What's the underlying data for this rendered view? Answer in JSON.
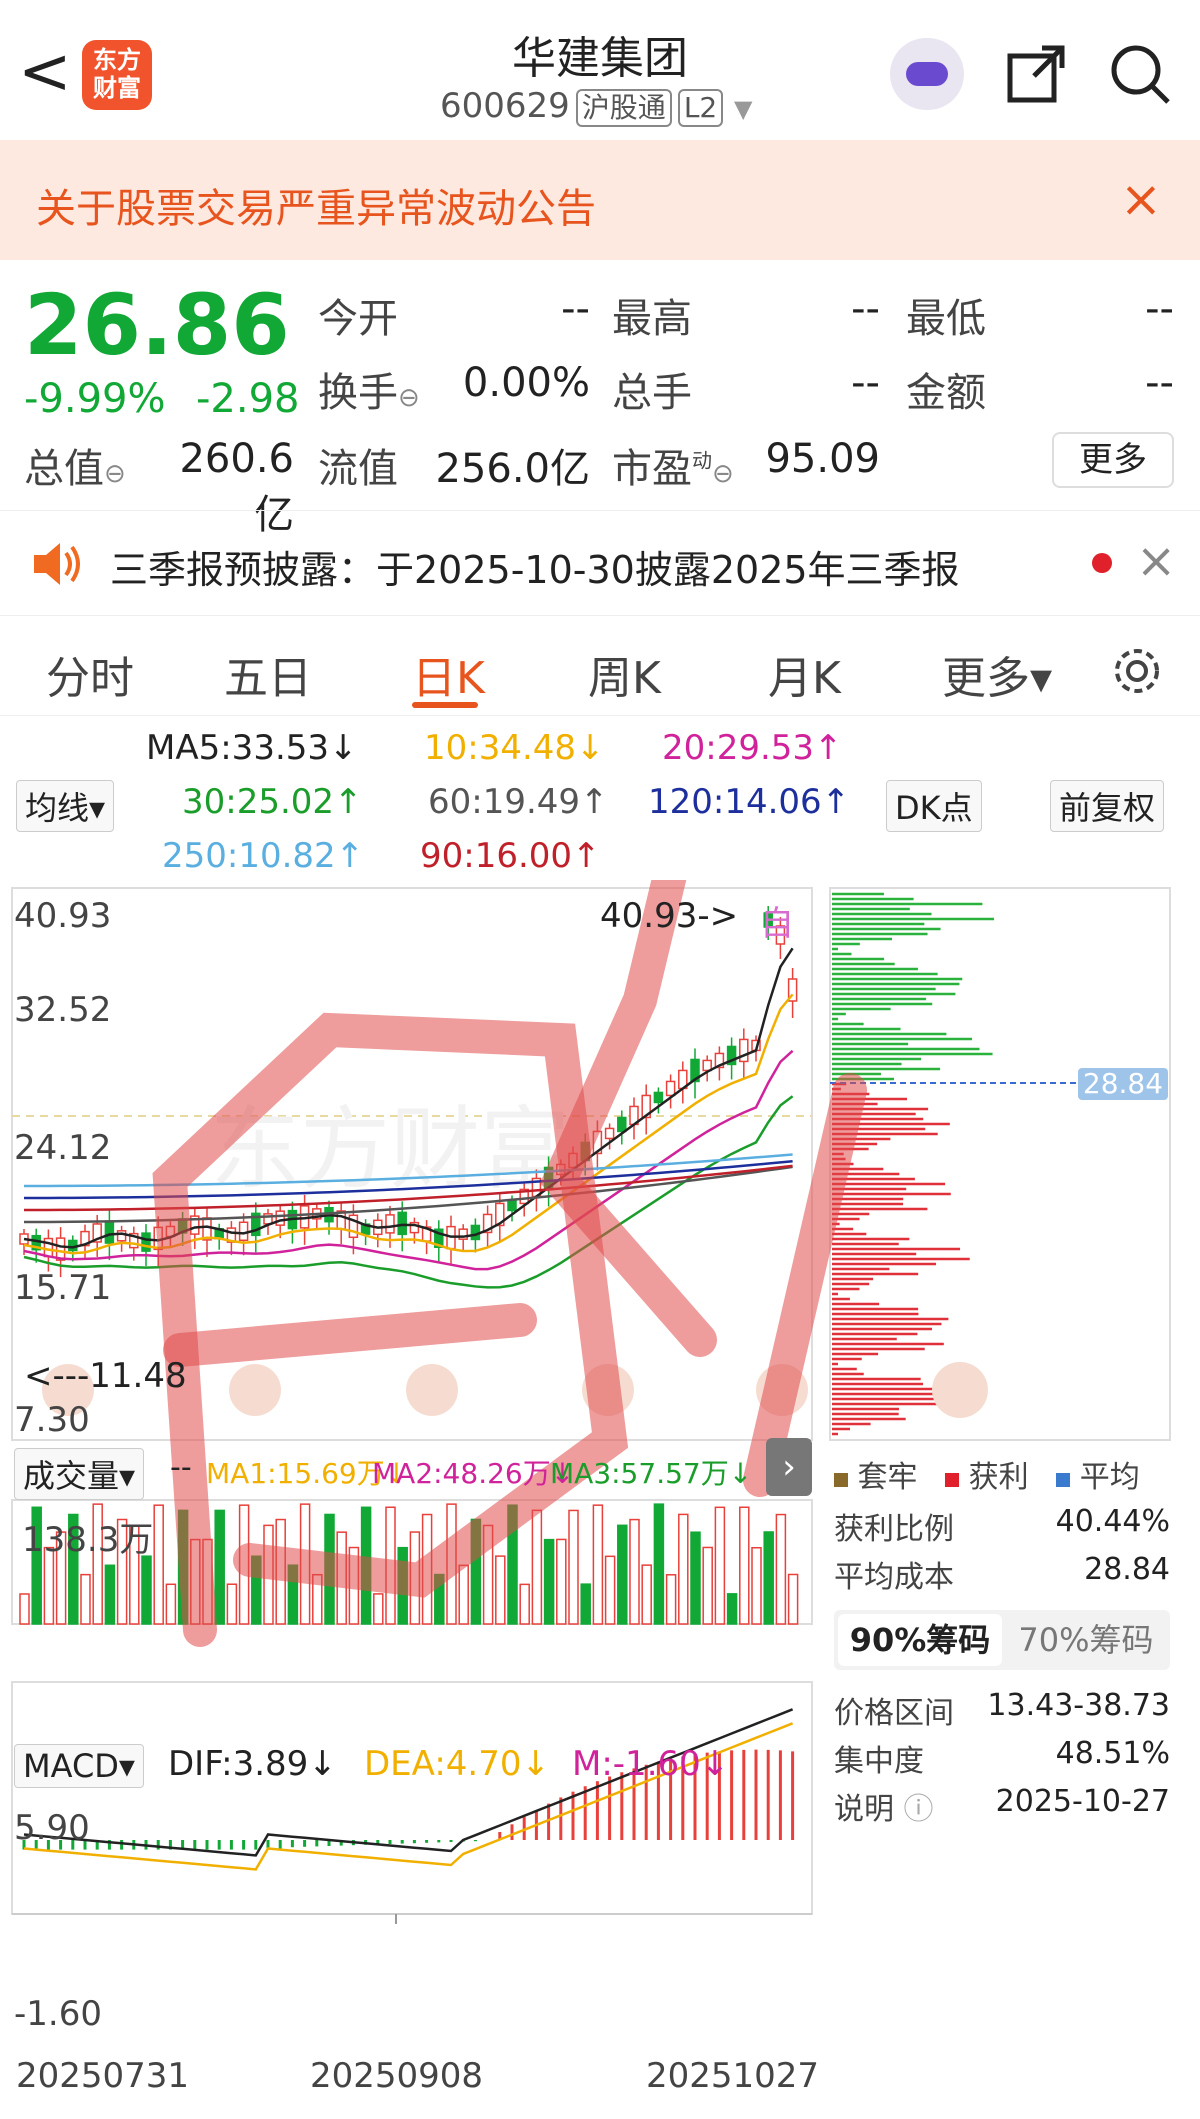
{
  "header": {
    "back_label": "<",
    "logo_text": "东方财富",
    "stock_name": "华建集团",
    "stock_code": "600629",
    "tag1": "沪股通",
    "tag2": "L2"
  },
  "notice": {
    "text": "关于股票交易严重异常波动公告",
    "close": "×"
  },
  "quote": {
    "price": "26.86",
    "change_pct": "-9.99%",
    "change": "-2.98",
    "open_label": "今开",
    "open": "--",
    "high_label": "最高",
    "high": "--",
    "low_label": "最低",
    "low": "--",
    "turnover_label": "换手",
    "turnover": "0.00%",
    "volume_label": "总手",
    "volume": "--",
    "amount_label": "金额",
    "amount": "--",
    "mcap_label": "总值",
    "mcap": "260.6亿",
    "float_label": "流值",
    "float": "256.0亿",
    "pe_label": "市盈",
    "pe_sup": "动",
    "pe": "95.09",
    "more_label": "更多"
  },
  "announcement": {
    "text": "三季报预披露：于2025-10-30披露2025年三季报",
    "close": "×"
  },
  "tabs": [
    "分时",
    "五日",
    "日K",
    "周K",
    "月K",
    "更多▾"
  ],
  "active_tab": "日K",
  "ma": {
    "ma5": "MA5:33.53↓",
    "ma10": "10:34.48↓",
    "ma20": "20:29.53↑",
    "ma30": "30:25.02↑",
    "ma60": "60:19.49↑",
    "ma120": "120:14.06↑",
    "ma250": "250:10.82↑",
    "ma90": "90:16.00↑",
    "junxian": "均线▾",
    "dk": "DK点",
    "fuquan": "前复权"
  },
  "kline": {
    "y_labels": [
      "40.93",
      "32.52",
      "24.12",
      "15.71",
      "7.30"
    ],
    "high_marker": "40.93->",
    "low_marker": "<---11.48",
    "chip_price": "28.84",
    "self_tag": "自"
  },
  "volume": {
    "label": "成交量▾",
    "ma1": "MA1:15.69万↓",
    "ma2": "MA2:48.26万↓",
    "ma3": "MA3:57.57万↓",
    "top": "138.3万"
  },
  "macd": {
    "label": "MACD▾",
    "dif": "DIF:3.89↓",
    "dea": "DEA:4.70↓",
    "m": "M:-1.60↓",
    "top": "5.90",
    "bottom": "-1.60"
  },
  "dates": [
    "20250731",
    "20250908",
    "20251027"
  ],
  "chip": {
    "legend": [
      "套牢",
      "获利",
      "平均"
    ],
    "profit_ratio_label": "获利比例",
    "profit_ratio": "40.44%",
    "avg_cost_label": "平均成本",
    "avg_cost": "28.84",
    "tab90": "90%筹码",
    "tab70": "70%筹码",
    "range_label": "价格区间",
    "range": "13.43-38.73",
    "conc_label": "集中度",
    "conc": "48.51%",
    "note_label": "说明",
    "note_date": "2025-10-27"
  },
  "colors": {
    "up": "#e8403a",
    "down": "#11a836",
    "accent": "#e8541e"
  }
}
